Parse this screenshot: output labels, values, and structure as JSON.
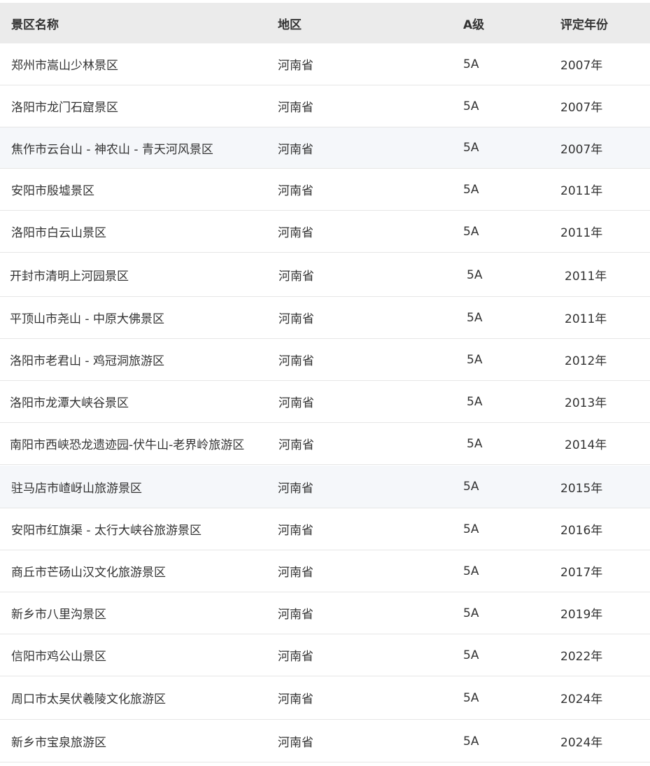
{
  "headers": {
    "name": "景区名称",
    "region": "地区",
    "grade": "A级",
    "year": "评定年份"
  },
  "rows": [
    {
      "name": "郑州市嵩山少林景区",
      "region": "河南省",
      "grade": "5A",
      "year": "2007年"
    },
    {
      "name": "洛阳市龙门石窟景区",
      "region": "河南省",
      "grade": "5A",
      "year": "2007年"
    },
    {
      "name": "焦作市云台山 - 神农山 - 青天河风景区",
      "region": "河南省",
      "grade": "5A",
      "year": "2007年"
    },
    {
      "name": "安阳市殷墟景区",
      "region": "河南省",
      "grade": "5A",
      "year": "2011年"
    },
    {
      "name": "洛阳市白云山景区",
      "region": "河南省",
      "grade": "5A",
      "year": "2011年"
    },
    {
      "name": "开封市清明上河园景区",
      "region": "河南省",
      "grade": "5A",
      "year": "2011年"
    },
    {
      "name": "平顶山市尧山 - 中原大佛景区",
      "region": "河南省",
      "grade": "5A",
      "year": "2011年"
    },
    {
      "name": "洛阳市老君山 - 鸡冠洞旅游区",
      "region": "河南省",
      "grade": "5A",
      "year": "2012年"
    },
    {
      "name": "洛阳市龙潭大峡谷景区",
      "region": "河南省",
      "grade": "5A",
      "year": "2013年"
    },
    {
      "name": "南阳市西峡恐龙遗迹园-伏牛山-老界岭旅游区",
      "region": "河南省",
      "grade": "5A",
      "year": "2014年"
    },
    {
      "name": "驻马店市嵖岈山旅游景区",
      "region": "河南省",
      "grade": "5A",
      "year": "2015年"
    },
    {
      "name": "安阳市红旗渠 - 太行大峡谷旅游景区",
      "region": "河南省",
      "grade": "5A",
      "year": "2016年"
    },
    {
      "name": "商丘市芒砀山汉文化旅游景区",
      "region": "河南省",
      "grade": "5A",
      "year": "2017年"
    },
    {
      "name": "新乡市八里沟景区",
      "region": "河南省",
      "grade": "5A",
      "year": "2019年"
    },
    {
      "name": "信阳市鸡公山景区",
      "region": "河南省",
      "grade": "5A",
      "year": "2022年"
    },
    {
      "name": "周口市太昊伏羲陵文化旅游区",
      "region": "河南省",
      "grade": "5A",
      "year": "2024年"
    },
    {
      "name": "新乡市宝泉旅游区",
      "region": "河南省",
      "grade": "5A",
      "year": "2024年"
    }
  ]
}
